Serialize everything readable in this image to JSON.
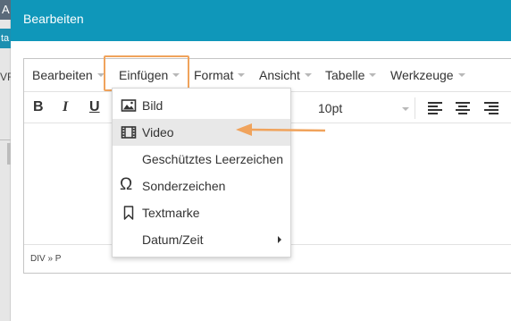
{
  "background": {
    "tab1_text": "A",
    "tab2_text": "ta",
    "tab3_text": "VF"
  },
  "dialog": {
    "title": "Bearbeiten"
  },
  "menubar": {
    "items": [
      {
        "label": "Bearbeiten"
      },
      {
        "label": "Einfügen"
      },
      {
        "label": "Format"
      },
      {
        "label": "Ansicht"
      },
      {
        "label": "Tabelle"
      },
      {
        "label": "Werkzeuge"
      }
    ]
  },
  "toolbar": {
    "bold": "B",
    "italic": "I",
    "underline": "U",
    "font_size": "10pt"
  },
  "dropdown": {
    "items": [
      {
        "label": "Bild",
        "icon": "image-icon"
      },
      {
        "label": "Video",
        "icon": "film-icon",
        "active": true
      },
      {
        "label": "Geschütztes Leerzeichen",
        "icon": ""
      },
      {
        "label": "Sonderzeichen",
        "icon": "omega-icon"
      },
      {
        "label": "Textmarke",
        "icon": "bookmark-icon"
      },
      {
        "label": "Datum/Zeit",
        "icon": "",
        "has_submenu": true
      }
    ]
  },
  "statusbar": {
    "path": "DIV » P"
  },
  "colors": {
    "header": "#0f97ba",
    "highlight": "#f0a35c",
    "arrow": "#f0a35c"
  }
}
